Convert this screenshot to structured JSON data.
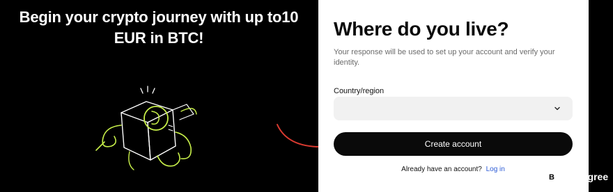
{
  "promo": {
    "line1": "Begin your crypto journey with up to10",
    "line2": "EUR in BTC!"
  },
  "form": {
    "title": "Where do you live?",
    "subtitle": "Your response will be used to set up your account and verify your identity.",
    "country_label": "Country/region",
    "country_value": "",
    "create_button": "Create account",
    "login_prompt": "Already have an account?",
    "login_link": "Log in"
  },
  "watermark": {
    "brand": "BitDegree"
  },
  "colors": {
    "accent_green": "#c8f04a",
    "arrow_red": "#d93a30",
    "link_blue": "#2d5bd6",
    "button_black": "#0a0a0a"
  },
  "icons": [
    "gift-box-illustration",
    "chevron-down-icon",
    "red-arrow",
    "bitdegree-logo-icon"
  ]
}
